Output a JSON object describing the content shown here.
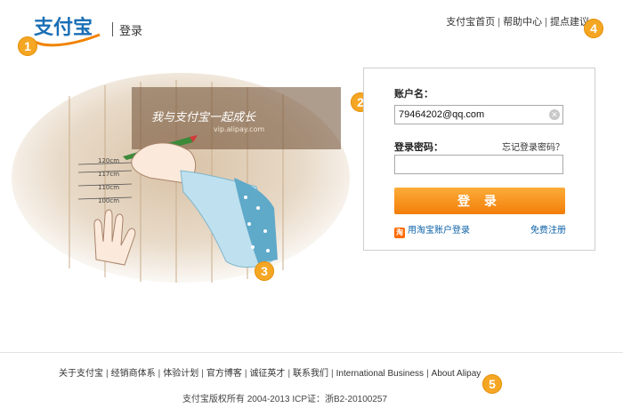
{
  "header": {
    "logo_text": "支付宝",
    "title": "登录",
    "nav": [
      "支付宝首页",
      "帮助中心",
      "提点建议"
    ]
  },
  "badges": [
    "1",
    "2",
    "3",
    "4",
    "5"
  ],
  "illustration": {
    "caption": "我与支付宝一起成长",
    "url_text": "vip.alipay.com",
    "marks": [
      "120cm",
      "117cm",
      "110cm",
      "100cm"
    ]
  },
  "login": {
    "account_label": "账户名：",
    "account_value": "79464202@qq.com",
    "password_label": "登录密码：",
    "forgot": "忘记登录密码？",
    "button": "登 录",
    "taobao_icon": "淘",
    "taobao": "用淘宝账户登录",
    "register": "免费注册"
  },
  "footer": {
    "links": [
      "关于支付宝",
      "经销商体系",
      "体验计划",
      "官方博客",
      "诚征英才",
      "联系我们",
      "International Business",
      "About Alipay"
    ],
    "copyright": "支付宝版权所有 2004-2013 ICP证：浙B2-20100257"
  },
  "colors": {
    "accent": "#f5a623",
    "button": "#f58a12",
    "link": "#0d62a8"
  }
}
